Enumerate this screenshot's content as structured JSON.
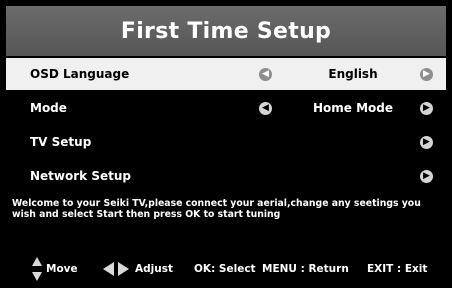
{
  "header": {
    "title": "First Time Setup"
  },
  "menu": {
    "items": [
      {
        "label": "OSD Language",
        "value": "English",
        "left_icon": "chevron-left-icon",
        "right_icon": "chevron-right-icon"
      },
      {
        "label": "Mode",
        "value": "Home Mode",
        "left_icon": "chevron-left-icon",
        "right_icon": "chevron-right-icon"
      },
      {
        "label": "TV Setup",
        "right_icon": "chevron-right-icon"
      },
      {
        "label": "Network Setup",
        "right_icon": "chevron-right-icon"
      }
    ]
  },
  "message": "Welcome to your Seiki TV,please connect your aerial,change any seetings you\nwish and select Start then press OK to start tuning",
  "footer": {
    "move": "Move",
    "adjust": "Adjust",
    "ok_label": "OK: Select",
    "menu_label": "MENU : Return",
    "exit_label": "EXIT : Exit"
  },
  "colors": {
    "header_bg": "#626262",
    "selected_bg": "#f0f0f0",
    "background": "#000000"
  }
}
